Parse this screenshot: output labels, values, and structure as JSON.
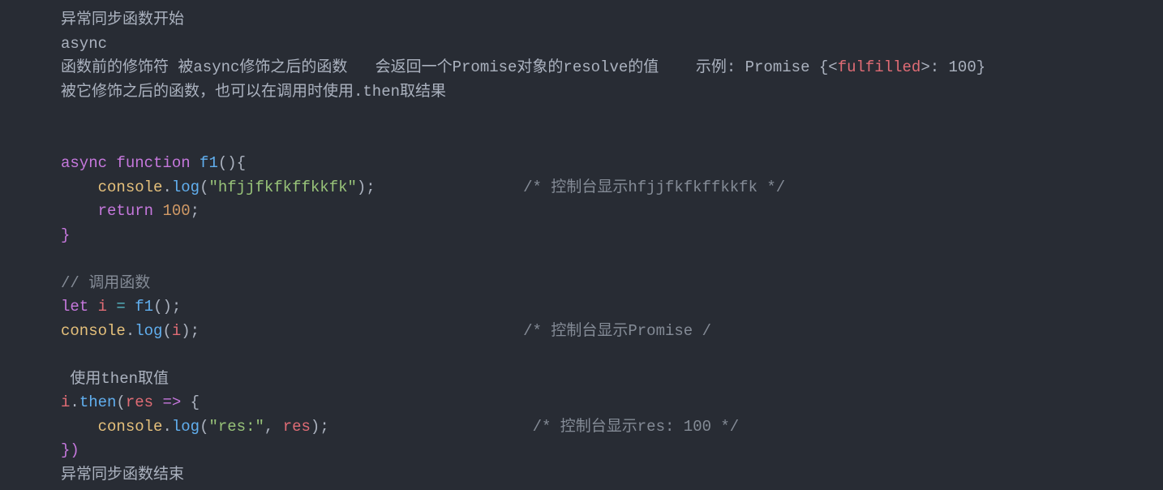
{
  "lines": {
    "l1": {
      "t1": "异常同步函数开始"
    },
    "l2": {
      "t1": "async"
    },
    "l3": {
      "t1": "函数前的修饰符 被async修饰之后的函数   会返回一个Promise对象的resolve的值    示例: Promise {<",
      "t2": "fulfilled",
      "t3": ">: 100}"
    },
    "l4": {
      "t1": "被它修饰之后的函数，也可以在调用时使用.then取结果"
    },
    "l7": {
      "k1": "async",
      "k2": "function",
      "f1": "f1",
      "p1": "(){"
    },
    "l8": {
      "indent": "    ",
      "obj": "console",
      "dot": ".",
      "func": "log",
      "p1": "(",
      "str": "\"hfjjfkfkffkkfk\"",
      "p2": ");",
      "pad": "                ",
      "comment": "/* 控制台显示hfjjfkfkffkkfk */"
    },
    "l9": {
      "indent": "    ",
      "kw": "return",
      "sp": " ",
      "num": "100",
      "p": ";"
    },
    "l10": {
      "p": "}"
    },
    "l12": {
      "comment": "// 调用函数"
    },
    "l13": {
      "kw": "let",
      "sp": " ",
      "var": "i",
      "eq": " = ",
      "func": "f1",
      "p": "();"
    },
    "l14": {
      "obj": "console",
      "dot": ".",
      "func": "log",
      "p1": "(",
      "var": "i",
      "p2": ");",
      "pad": "                                   ",
      "comment": "/* 控制台显示Promise /"
    },
    "l16": {
      "sp": " ",
      "t1": "使用then取值"
    },
    "l17": {
      "var": "i",
      "dot": ".",
      "func": "then",
      "p1": "(",
      "arg": "res",
      "arrow": " => ",
      "p2": "{"
    },
    "l18": {
      "indent": "    ",
      "obj": "console",
      "dot": ".",
      "func": "log",
      "p1": "(",
      "str": "\"res:\"",
      "comma": ", ",
      "var": "res",
      "p2": ");",
      "pad": "                      ",
      "comment": "/* 控制台显示res: 100 */"
    },
    "l19": {
      "p": "})"
    },
    "l20": {
      "t1": "异常同步函数结束"
    }
  }
}
